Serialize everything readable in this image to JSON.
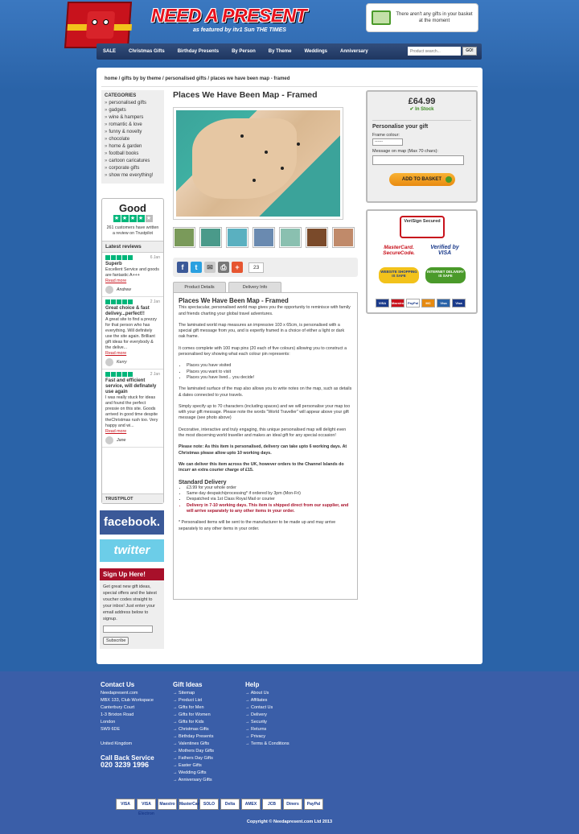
{
  "header": {
    "logo_text": "NEED A PRESENT",
    "logo_sub": "as featured by itv1 Sun THE TIMES",
    "basket_text": "There aren't any gifts in your basket at the moment"
  },
  "nav": {
    "items": [
      "SALE",
      "Christmas Gifts",
      "Birthday Presents",
      "By Person",
      "By Theme",
      "Weddings",
      "Anniversary"
    ],
    "search_placeholder": "Product search...",
    "go_label": "GO!"
  },
  "breadcrumb": "home / gifts by by theme / personalised gifts / places we have been map - framed",
  "categories": {
    "title": "CATEGORIES",
    "items": [
      "personalised gifts",
      "gadgets",
      "wine & hampers",
      "romantic & love",
      "funny & novelty",
      "chocolate",
      "home & garden",
      "football books",
      "cartoon caricatures",
      "corporate gifts",
      "show me everything!"
    ]
  },
  "trustpilot": {
    "rating": "Good",
    "count_text": "261 customers have written a review on Trustpilot",
    "latest": "Latest reviews",
    "reviews": [
      {
        "date": "6 Jan",
        "title": "Superb",
        "body": "Excellent Service and goods are fantastic A+++",
        "more": "Read more",
        "author": "Andrew"
      },
      {
        "date": "2 Jan",
        "title": "Great choice & fast delivey...perfect!!",
        "body": "A great site to find a prezzy for that person who has everything. Will definitely use the site again. Brilliant gift ideas for everybody & the delive...",
        "more": "Read more",
        "author": "Kerry"
      },
      {
        "date": "2 Jan",
        "title": "Fast and efficient service, will definately use again",
        "body": "I was really stuck for ideas and found the perfect pressie on this site. Goods arrived in good time despite theChristmas rush too. Very happy and wi...",
        "more": "Read more",
        "author": "Jane"
      }
    ],
    "footer": "TRUSTPILOT"
  },
  "social": {
    "facebook": "facebook.",
    "twitter": "twitter"
  },
  "signup": {
    "title": "Sign Up Here!",
    "text": "Get great new gift ideas, special offers and the latest voucher codes straight to your inbox! Just enter your email address below to signup.",
    "button": "Subscribe"
  },
  "product": {
    "title": "Places We Have Been Map - Framed",
    "share_count": "23",
    "tabs": [
      "Product Details",
      "Delivery Info"
    ],
    "desc_title": "Places We Have Been Map - Framed",
    "para1": "This spectacular, personalised world map gives you the opportunity to reminisce with family and friends charting your global travel adventures.",
    "para2": "The laminated world map measures an impressive 103 x 65cm, is personalised with a special gift message from you, and is expertly framed in a choice of either a light or dark oak frame.",
    "para3": "It comes complete with 100 map pins (20 each of five colours) allowing you to construct a personalised key showing what each colour pin represents:",
    "bullets": [
      "Places you have visited",
      "Places you want to visit",
      "Places you have lived... you decide!"
    ],
    "para4": "The laminated surface of the map also allows you to write notes on the map, such as details & dates connected to your travels.",
    "para5": "Simply specify up to 70 characters (including spaces) and we will personalise your map too with your gift message. Please note the words \"World Traveller\" will appear above your gift message (see photo above)",
    "para6": "Decorative, interactive and truly engaging, this unique personalised map will delight even the most discerning world traveller and makes an ideal gift for any special occasion!",
    "note1": "Please note: As this item is personalised, delivery can take upto 6 working days. At Christmas please allow upto 10 working days.",
    "note2": "We can deliver this item across the UK, however orders to the Channel Islands do incurr an extra courier charge of £15.",
    "delivery_title": "Standard Delivery",
    "delivery": [
      "£3.99 for your whole order",
      "Same day despatch/processing* if ordered by 3pm (Mon-Fri)",
      "Despatched via 1st Class Royal Mail or courier"
    ],
    "delivery_red": "Delivery in 7-10 working days. This item is shipped direct from our supplier, and will arrive separately to any other items in your order.",
    "footnote": "* Personalised items will be sent to the manufacturer to be made up and may arrive separately to any other items in your order."
  },
  "buy": {
    "price": "£64.99",
    "stock": "In Stock",
    "heading": "Personalise your gift",
    "frame_label": "Frame colour:",
    "frame_value": "------",
    "msg_label": "Message on map (Max 70 chars):",
    "add_label": "ADD TO BASKET"
  },
  "security": {
    "verisign": "VeriSign Secured",
    "mastercard": "MasterCard. SecureCode.",
    "visa": "Verified by VISA",
    "shop_safe": "WEBSITE SHOPPING IS SAFE",
    "delivery_safe": "INTERNET DELIVERY IS SAFE",
    "cards": [
      "VISA",
      "Maestro",
      "PayPal",
      "MC",
      "Visa",
      "Visa"
    ]
  },
  "footer": {
    "contact_title": "Contact Us",
    "address": [
      "Needapresent.com",
      "MBX 133, Club Workspace",
      "Canterbury Court",
      "1-3 Brixton Road",
      "London",
      "SW9 6DE",
      "",
      "United Kingdom"
    ],
    "call_title": "Call Back Service",
    "phone": "020 3239 1996",
    "gift_title": "Gift Ideas",
    "gift_links": [
      "Sitemap",
      "Product List",
      "Gifts for Men",
      "Gifts for Women",
      "Gifts for Kids",
      "Christmas Gifts",
      "Birthday Presents",
      "Valentines Gifts",
      "Mothers Day Gifts",
      "Fathers Day Gifts",
      "Easter Gifts",
      "Wedding Gifts",
      "Anniversary Gifts"
    ],
    "help_title": "Help",
    "help_links": [
      "About Us",
      "Affiliates",
      "Contact Us",
      "Delivery",
      "Security",
      "Returns",
      "Privacy",
      "Terms & Conditions"
    ],
    "payments": [
      "VISA",
      "VISA Electron",
      "Maestro",
      "MasterCard",
      "SOLO",
      "Delta",
      "AMEX",
      "JCB",
      "Diners",
      "PayPal"
    ],
    "copyright": "Copyright © Needapresent.com Ltd 2013"
  }
}
